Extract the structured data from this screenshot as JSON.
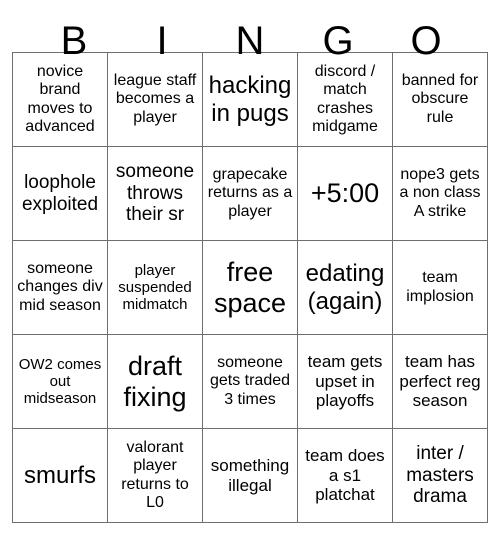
{
  "card": {
    "title": "BINGO",
    "header_letters": [
      "B",
      "I",
      "N",
      "G",
      "O"
    ],
    "columns": 5,
    "rows": 5,
    "colors": {
      "background": "#ffffff",
      "text": "#000000",
      "grid_line": "#6e6e6e"
    },
    "cells": [
      [
        {
          "text": "novice brand moves to advanced",
          "size": "sm"
        },
        {
          "text": "league staff becomes a player",
          "size": "sm"
        },
        {
          "text": "hacking in pugs",
          "size": "xl"
        },
        {
          "text": "discord / match crashes midgame",
          "size": "sm"
        },
        {
          "text": "banned for obscure rule",
          "size": "sm"
        }
      ],
      [
        {
          "text": "loophole exploited",
          "size": "lg"
        },
        {
          "text": "someone throws their sr",
          "size": "lg"
        },
        {
          "text": "grapecake returns as a player",
          "size": "sm"
        },
        {
          "text": "+5:00",
          "size": "xxl"
        },
        {
          "text": "nope3 gets a non class A strike",
          "size": "sm"
        }
      ],
      [
        {
          "text": "someone changes div mid season",
          "size": "sm"
        },
        {
          "text": "player suspended midmatch",
          "size": "xs"
        },
        {
          "text": "free space",
          "size": "xxl"
        },
        {
          "text": "edating (again)",
          "size": "xl"
        },
        {
          "text": "team implosion",
          "size": "sm"
        }
      ],
      [
        {
          "text": "OW2 comes out midseason",
          "size": "xs"
        },
        {
          "text": "draft fixing",
          "size": "xxl"
        },
        {
          "text": "someone gets traded 3 times",
          "size": "sm"
        },
        {
          "text": "team gets upset in playoffs",
          "size": "md"
        },
        {
          "text": "team has perfect reg season",
          "size": "md"
        }
      ],
      [
        {
          "text": "smurfs",
          "size": "xl"
        },
        {
          "text": "valorant player returns to L0",
          "size": "sm"
        },
        {
          "text": "something illegal",
          "size": "md"
        },
        {
          "text": "team does a s1 platchat",
          "size": "md"
        },
        {
          "text": "inter / masters drama",
          "size": "lg"
        }
      ]
    ]
  }
}
